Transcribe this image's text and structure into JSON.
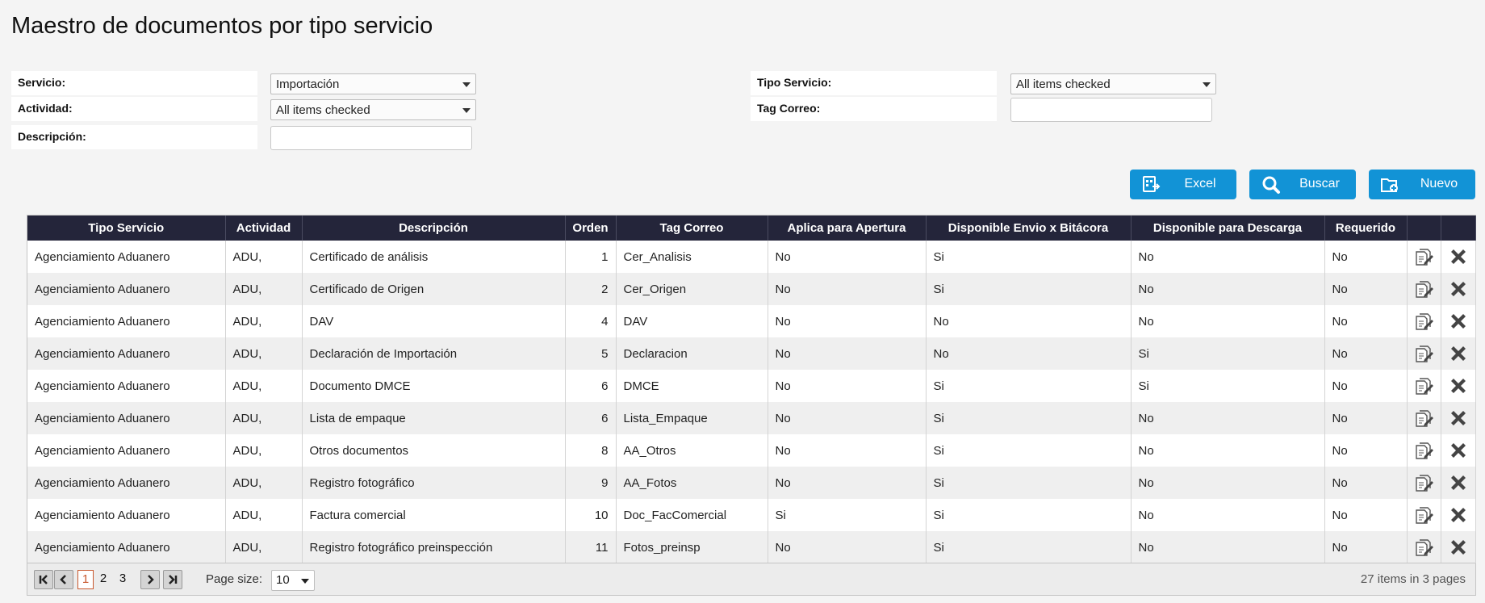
{
  "page": {
    "title": "Maestro de documentos por tipo servicio"
  },
  "filters": {
    "servicio": {
      "label": "Servicio:",
      "value": "Importación"
    },
    "actividad": {
      "label": "Actividad:",
      "value": "All items checked"
    },
    "descripcion": {
      "label": "Descripción:",
      "value": ""
    },
    "tipo_servicio": {
      "label": "Tipo Servicio:",
      "value": "All items checked"
    },
    "tag_correo": {
      "label": "Tag Correo:",
      "value": ""
    }
  },
  "buttons": {
    "excel": "Excel",
    "buscar": "Buscar",
    "nuevo": "Nuevo"
  },
  "colors": {
    "accent": "#1293d6",
    "header_bg": "#24253a",
    "delete_icon": "#444444"
  },
  "table": {
    "columns": [
      "Tipo Servicio",
      "Actividad",
      "Descripción",
      "Orden",
      "Tag Correo",
      "Aplica para Apertura",
      "Disponible Envio x Bitácora",
      "Disponible para Descarga",
      "Requerido",
      "",
      ""
    ],
    "rows": [
      {
        "tipo": "Agenciamiento Aduanero",
        "actividad": "ADU,",
        "descripcion": "Certificado de análisis",
        "orden": "1",
        "tag": "Cer_Analisis",
        "apertura": "No",
        "bitacora": "Si",
        "descarga": "No",
        "requerido": "No"
      },
      {
        "tipo": "Agenciamiento Aduanero",
        "actividad": "ADU,",
        "descripcion": "Certificado de Origen",
        "orden": "2",
        "tag": "Cer_Origen",
        "apertura": "No",
        "bitacora": "Si",
        "descarga": "No",
        "requerido": "No"
      },
      {
        "tipo": "Agenciamiento Aduanero",
        "actividad": "ADU,",
        "descripcion": "DAV",
        "orden": "4",
        "tag": "DAV",
        "apertura": "No",
        "bitacora": "No",
        "descarga": "No",
        "requerido": "No"
      },
      {
        "tipo": "Agenciamiento Aduanero",
        "actividad": "ADU,",
        "descripcion": "Declaración de Importación",
        "orden": "5",
        "tag": "Declaracion",
        "apertura": "No",
        "bitacora": "No",
        "descarga": "Si",
        "requerido": "No"
      },
      {
        "tipo": "Agenciamiento Aduanero",
        "actividad": "ADU,",
        "descripcion": "Documento DMCE",
        "orden": "6",
        "tag": "DMCE",
        "apertura": "No",
        "bitacora": "Si",
        "descarga": "Si",
        "requerido": "No"
      },
      {
        "tipo": "Agenciamiento Aduanero",
        "actividad": "ADU,",
        "descripcion": "Lista de empaque",
        "orden": "6",
        "tag": "Lista_Empaque",
        "apertura": "No",
        "bitacora": "Si",
        "descarga": "No",
        "requerido": "No"
      },
      {
        "tipo": "Agenciamiento Aduanero",
        "actividad": "ADU,",
        "descripcion": "Otros documentos",
        "orden": "8",
        "tag": "AA_Otros",
        "apertura": "No",
        "bitacora": "Si",
        "descarga": "No",
        "requerido": "No"
      },
      {
        "tipo": "Agenciamiento Aduanero",
        "actividad": "ADU,",
        "descripcion": "Registro fotográfico",
        "orden": "9",
        "tag": "AA_Fotos",
        "apertura": "No",
        "bitacora": "Si",
        "descarga": "No",
        "requerido": "No"
      },
      {
        "tipo": "Agenciamiento Aduanero",
        "actividad": "ADU,",
        "descripcion": "Factura comercial",
        "orden": "10",
        "tag": "Doc_FacComercial",
        "apertura": "Si",
        "bitacora": "Si",
        "descarga": "No",
        "requerido": "No"
      },
      {
        "tipo": "Agenciamiento Aduanero",
        "actividad": "ADU,",
        "descripcion": "Registro fotográfico preinspección",
        "orden": "11",
        "tag": "Fotos_preinsp",
        "apertura": "No",
        "bitacora": "Si",
        "descarga": "No",
        "requerido": "No"
      }
    ],
    "row_icons": {
      "edit": "edit-document-icon",
      "delete": "delete-x-icon"
    }
  },
  "pager": {
    "pages": [
      "1",
      "2",
      "3"
    ],
    "current": "1",
    "page_size_label": "Page size:",
    "page_size": "10",
    "info": "27 items in 3 pages"
  }
}
